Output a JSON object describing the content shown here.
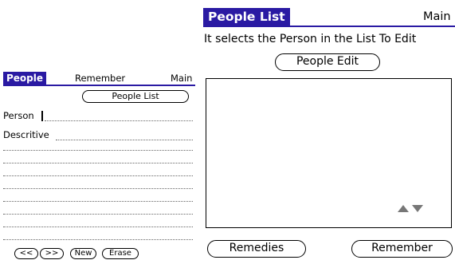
{
  "left_screen": {
    "title": "People",
    "menu_remember": "Remember",
    "menu_main": "Main",
    "people_list_button": "People List",
    "person_label": "Person",
    "descriptive_label": "Descritive",
    "buttons": {
      "prev": "<<",
      "next": ">>",
      "new": "New",
      "erase": "Erase"
    }
  },
  "right_screen": {
    "title": "People List",
    "menu_main": "Main",
    "instruction": "It selects the Person in the List To Edit",
    "people_edit_button": "People Edit",
    "remedies_button": "Remedies",
    "remember_button": "Remember",
    "scroll_arrows": "up-down-scroll-icon"
  },
  "colors": {
    "title_bar": "#2a1aa3"
  }
}
